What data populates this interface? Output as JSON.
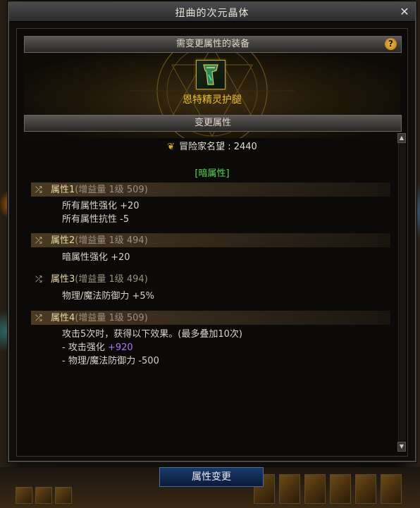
{
  "window": {
    "title": "扭曲的次元晶体",
    "close_glyph": "✕"
  },
  "section_equipment": {
    "label": "需变更属性的装备",
    "help_glyph": "?"
  },
  "item": {
    "name": "恩特精灵护腿",
    "icon": "leg-armor-icon"
  },
  "section_change": {
    "label": "变更属性"
  },
  "fame": {
    "label": "冒险家名望 : 2440",
    "icon": "fame-emblem-icon"
  },
  "element": {
    "label": "[暗属性]"
  },
  "attributes": [
    {
      "name": "属性1",
      "meta": "(增益量 1级 509)",
      "lines": [
        "所有属性强化 +20",
        "所有属性抗性 -5"
      ]
    },
    {
      "name": "属性2",
      "meta": "(增益量 1级 494)",
      "lines": [
        "暗属性强化 +20"
      ]
    },
    {
      "name": "属性3",
      "meta": "(增益量 1级 494)",
      "lines": [
        "物理/魔法防御力 +5%"
      ]
    },
    {
      "name": "属性4",
      "meta": "(增益量 1级 509)",
      "lines": [
        "攻击5次时，获得以下效果。(最多叠加10次)",
        "- 攻击强化",
        "+920",
        "- 物理/魔法防御力 -500"
      ]
    }
  ],
  "button": {
    "label": "属性变更"
  },
  "colors": {
    "accent_gold": "#f0c028",
    "element_green": "#58d858",
    "value_purple": "#a878f8"
  }
}
